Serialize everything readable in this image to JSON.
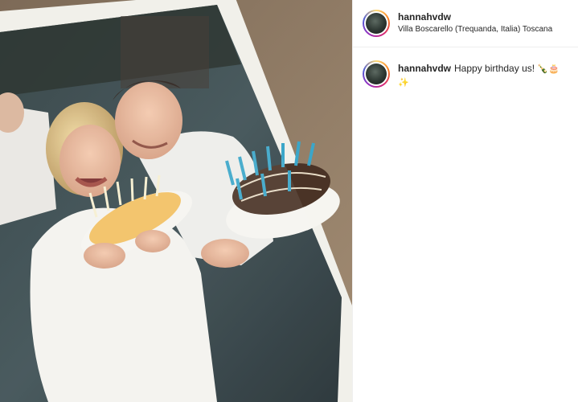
{
  "post": {
    "username": "hannahvdw",
    "location": "Villa Boscarello (Trequanda, Italia) Toscana",
    "caption_text": "Happy birthday us!",
    "caption_emoji_1": "🍾🎂",
    "caption_emoji_2": "✨"
  },
  "media": {
    "description_icon": "photo"
  },
  "colors": {
    "border": "#efefef",
    "text": "#262626"
  }
}
